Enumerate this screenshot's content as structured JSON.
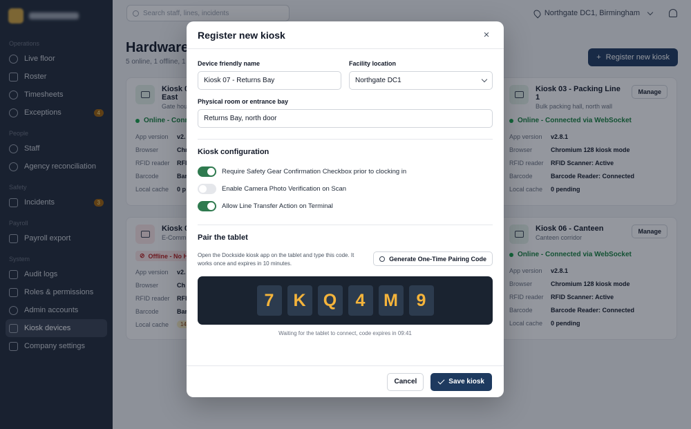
{
  "sidebar": {
    "groups": [
      {
        "label": "Operations",
        "items": [
          {
            "label": "Live floor"
          },
          {
            "label": "Roster"
          },
          {
            "label": "Timesheets"
          },
          {
            "label": "Exceptions",
            "badge": "4"
          }
        ]
      },
      {
        "label": "People",
        "items": [
          {
            "label": "Staff"
          },
          {
            "label": "Agency reconciliation"
          }
        ]
      },
      {
        "label": "Safety",
        "items": [
          {
            "label": "Incidents",
            "badge": "3"
          }
        ]
      },
      {
        "label": "Payroll",
        "items": [
          {
            "label": "Payroll export"
          }
        ]
      },
      {
        "label": "System",
        "items": [
          {
            "label": "Audit logs"
          },
          {
            "label": "Roles & permissions"
          },
          {
            "label": "Admin accounts"
          },
          {
            "label": "Kiosk devices"
          },
          {
            "label": "Company settings"
          }
        ]
      }
    ]
  },
  "topbar": {
    "search_placeholder": "Search staff, lines, incidents",
    "facility": "Northgate DC1, Birmingham"
  },
  "page": {
    "title": "Hardware",
    "subtitle": "5 online, 1 offline, 1",
    "register_button": "Register new kiosk"
  },
  "cards": {
    "c1": {
      "title": "Kiosk 0",
      "title2": "East",
      "sub": "Gate hou",
      "status": "Online - Conn",
      "rows": [
        {
          "k": "App version",
          "v": "v2."
        },
        {
          "k": "Browser",
          "v": "Chr"
        },
        {
          "k": "RFID reader",
          "v": "RFI"
        },
        {
          "k": "Barcode",
          "v": "Bar"
        },
        {
          "k": "Local cache",
          "v": "0 p"
        }
      ]
    },
    "c2": {
      "title": "Kiosk 03 - Packing Line 1",
      "sub": "Bulk packing hall, north wall",
      "manage": "Manage",
      "status": "Online - Connected via WebSocket",
      "rows": [
        {
          "k": "App version",
          "v": "v2.8.1"
        },
        {
          "k": "Browser",
          "v": "Chromium 128 kiosk mode"
        },
        {
          "k": "RFID reader",
          "v": "RFID Scanner: Active"
        },
        {
          "k": "Barcode",
          "v": "Barcode Reader: Connected"
        },
        {
          "k": "Local cache",
          "v": "0 pending"
        }
      ]
    },
    "c3": {
      "title": "Kiosk 0",
      "sub": "E-Comm",
      "status": "Offline - No He",
      "rows": [
        {
          "k": "App version",
          "v": "v2."
        },
        {
          "k": "Browser",
          "v": "Ch"
        },
        {
          "k": "RFID reader",
          "v": "RFI"
        },
        {
          "k": "Barcode",
          "v": "Bar"
        },
        {
          "k": "Local cache",
          "v": "14"
        }
      ]
    },
    "c4": {
      "title": "Kiosk 06 - Canteen",
      "sub": "Canteen corridor",
      "manage": "Manage",
      "status": "Online - Connected via WebSocket",
      "rows": [
        {
          "k": "App version",
          "v": "v2.8.1"
        },
        {
          "k": "Browser",
          "v": "Chromium 128 kiosk mode"
        },
        {
          "k": "RFID reader",
          "v": "RFID Scanner: Active"
        },
        {
          "k": "Barcode",
          "v": "Barcode Reader: Connected"
        },
        {
          "k": "Local cache",
          "v": "0 pending"
        }
      ]
    }
  },
  "modal": {
    "title": "Register new kiosk",
    "close_icon": "×",
    "device_name_label": "Device friendly name",
    "device_name_value": "Kiosk 07 - Returns Bay",
    "facility_label": "Facility location",
    "facility_value": "Northgate DC1",
    "room_label": "Physical room or entrance bay",
    "room_value": "Returns Bay, north door",
    "config_title": "Kiosk configuration",
    "toggles": [
      {
        "label": "Require Safety Gear Confirmation Checkbox prior to clocking in",
        "on": true
      },
      {
        "label": "Enable Camera Photo Verification on Scan",
        "on": false
      },
      {
        "label": "Allow Line Transfer Action on Terminal",
        "on": true
      }
    ],
    "pair_title": "Pair the tablet",
    "pair_desc": "Open the Dockside kiosk app on the tablet and type this code. It works once and expires in 10 minutes.",
    "generate_button": "Generate One-Time Pairing Code",
    "code": [
      "7",
      "K",
      "Q",
      "4",
      "M",
      "9"
    ],
    "wait_text": "Waiting for the tablet to connect, code expires in 09:41",
    "cancel_button": "Cancel",
    "save_button": "Save kiosk"
  },
  "colors": {
    "accent": "#1e3a5f",
    "toggle_on": "#2f7a4f",
    "code_text": "#f5b43b"
  }
}
